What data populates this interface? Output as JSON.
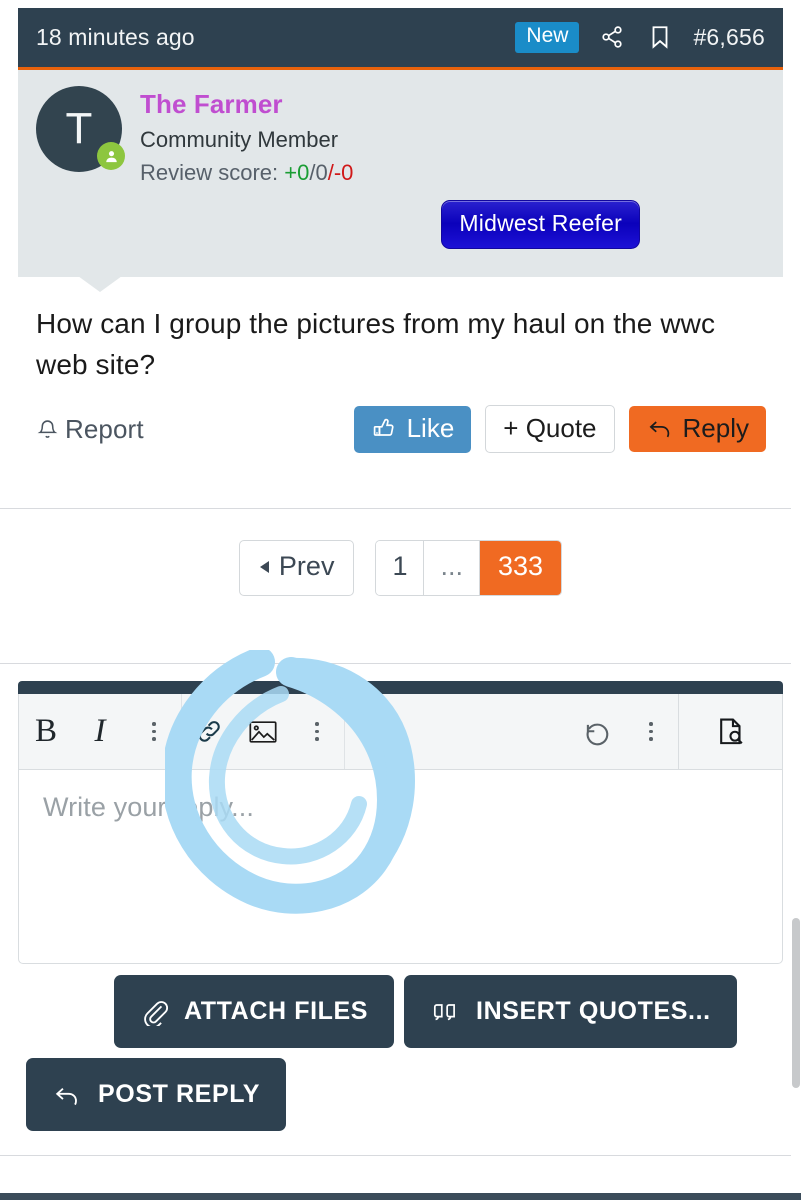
{
  "post": {
    "header": {
      "time": "18 minutes ago",
      "new_badge": "New",
      "share_icon": "share-icon",
      "bookmark_icon": "bookmark-icon",
      "post_number": "#6,656"
    },
    "user": {
      "avatar_initial": "T",
      "online_status_icon": "online-user-icon",
      "name": "The Farmer",
      "name_color": "#c04ed0",
      "title": "Community Member",
      "review_label": "Review score:",
      "review_positive": "+0",
      "review_neutral": "/0",
      "review_negative": "/-0",
      "badge": "Midwest Reefer"
    },
    "content": "How can I group the pictures from my haul on the wwc web site?",
    "actions": {
      "report_label": "Report",
      "report_icon": "bell-icon",
      "like_label": "Like",
      "like_icon": "thumbs-up-icon",
      "quote_label": "+ Quote",
      "reply_label": "Reply",
      "reply_icon": "reply-arrow-icon"
    }
  },
  "pagination": {
    "prev_label": "Prev",
    "prev_icon": "triangle-left-icon",
    "pages": [
      "1",
      "...",
      "333"
    ],
    "current_page": "333",
    "active_color": "#f06a22"
  },
  "editor": {
    "toolbar": {
      "bold_label": "B",
      "italic_label": "I",
      "more_text_icon": "kebab-menu-icon",
      "link_icon": "link-icon",
      "image_icon": "image-icon",
      "more_insert_icon": "kebab-menu-icon",
      "undo_icon": "undo-icon",
      "more_tools_icon": "kebab-menu-icon",
      "preview_icon": "document-preview-icon"
    },
    "placeholder": "Write your reply...",
    "value": ""
  },
  "bottom_buttons": {
    "attach_label": "ATTACH FILES",
    "attach_icon": "paperclip-icon",
    "insert_quotes_label": "INSERT QUOTES...",
    "insert_quotes_icon": "quote-marks-icon",
    "post_reply_label": "POST REPLY",
    "post_reply_icon": "reply-arrow-icon"
  },
  "annotation": {
    "shape": "hand-drawn-circle",
    "color": "#a9daf5"
  },
  "colors": {
    "header_bg": "#2e4150",
    "header_accent": "#e8620c",
    "user_panel_bg": "#e2e7e9",
    "orange": "#f06a22",
    "blue": "#4a90c4",
    "new_badge": "#1a8cc8",
    "online_green": "#8dc63f",
    "badge_blue": "#0b01bb"
  }
}
